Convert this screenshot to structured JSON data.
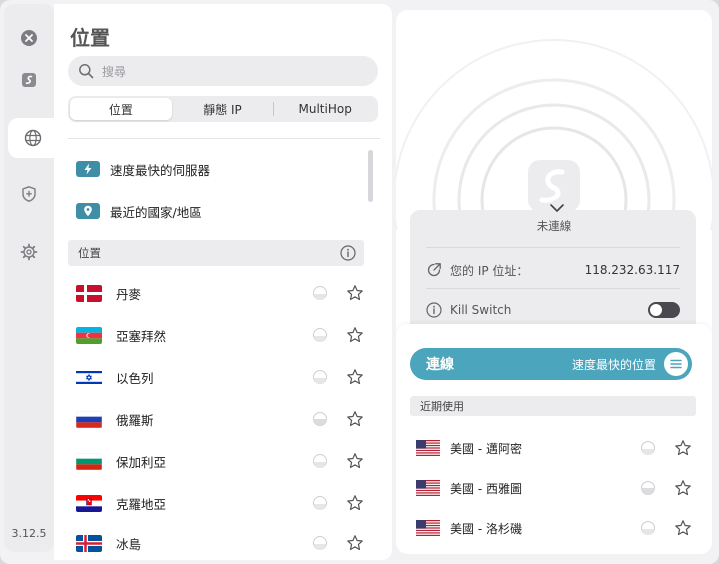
{
  "app": {
    "version": "3.12.5"
  },
  "rail": {
    "items": [
      {
        "icon": "close-icon"
      },
      {
        "icon": "surfshark-logo-icon"
      },
      {
        "icon": "globe-icon"
      },
      {
        "icon": "shield-plus-icon"
      },
      {
        "icon": "gear-icon"
      }
    ]
  },
  "locations": {
    "title": "位置",
    "search_placeholder": "搜尋",
    "tabs": [
      {
        "label": "位置",
        "active": true
      },
      {
        "label": "靜態 IP",
        "active": false
      },
      {
        "label": "MultiHop",
        "active": false
      }
    ],
    "quick": [
      {
        "label": "速度最快的伺服器",
        "icon": "bolt-icon"
      },
      {
        "label": "最近的國家/地區",
        "icon": "location-pin-icon"
      }
    ],
    "section_label": "位置",
    "countries": [
      {
        "name": "丹麥",
        "flag": "denmark"
      },
      {
        "name": "亞塞拜然",
        "flag": "azerbaijan"
      },
      {
        "name": "以色列",
        "flag": "israel"
      },
      {
        "name": "俄羅斯",
        "flag": "russia"
      },
      {
        "name": "保加利亞",
        "flag": "bulgaria"
      },
      {
        "name": "克羅地亞",
        "flag": "croatia"
      },
      {
        "name": "冰島",
        "flag": "iceland"
      }
    ]
  },
  "status": {
    "state": "未連線",
    "ip_label": "您的 IP 位址：",
    "ip_value": "118.232.63.117",
    "kill_switch_label": "Kill Switch",
    "kill_switch_on": false
  },
  "connect": {
    "label": "連線",
    "location": "速度最快的位置"
  },
  "recent": {
    "header": "近期使用",
    "items": [
      {
        "name": "美國 - 邁阿密",
        "flag": "usa"
      },
      {
        "name": "美國 - 西雅圖",
        "flag": "usa"
      },
      {
        "name": "美國 - 洛杉磯",
        "flag": "usa"
      }
    ]
  },
  "colors": {
    "accent": "#4aa5bd",
    "badge": "#3f8ea8"
  }
}
